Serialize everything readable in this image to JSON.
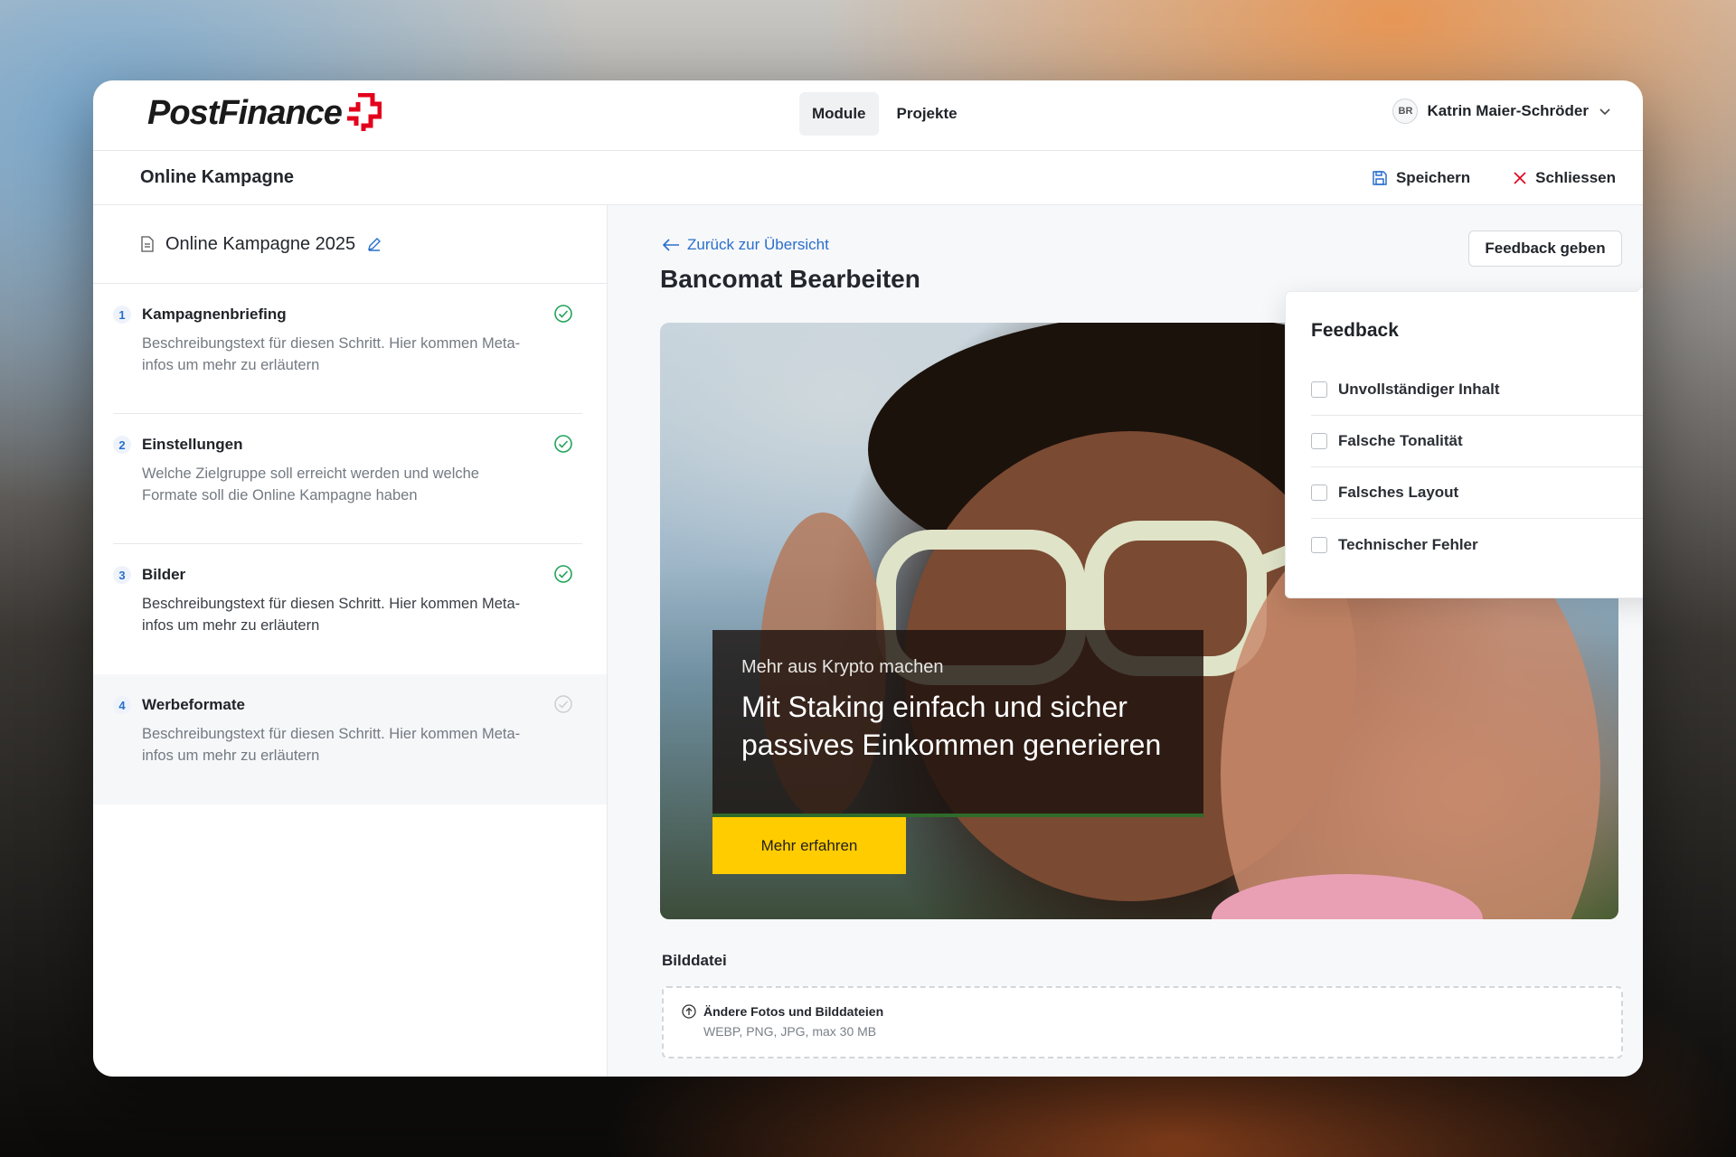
{
  "brand": {
    "logo_text": "PostFinance",
    "accent": "#e3001b"
  },
  "nav": {
    "items": [
      {
        "label": "Module",
        "active": true
      },
      {
        "label": "Projekte",
        "active": false
      }
    ]
  },
  "user": {
    "initials": "BR",
    "name": "Katrin Maier-Schröder"
  },
  "subheader": {
    "title": "Online Kampagne",
    "save_label": "Speichern",
    "close_label": "Schliessen"
  },
  "sidebar": {
    "project_name": "Online Kampagne 2025",
    "steps": [
      {
        "number": "1",
        "title": "Kampagnenbriefing",
        "description": "Beschreibungstext für diesen Schritt. Hier kommen Meta-infos um mehr zu erläutern",
        "status": "done"
      },
      {
        "number": "2",
        "title": "Einstellungen",
        "description": "Welche Zielgruppe soll erreicht werden und welche Formate soll die Online Kampagne haben",
        "status": "done"
      },
      {
        "number": "3",
        "title": "Bilder",
        "description": "Beschreibungstext für diesen Schritt. Hier kommen Meta-infos um mehr zu erläutern",
        "status": "done"
      },
      {
        "number": "4",
        "title": "Werbeformate",
        "description": "Beschreibungstext für diesen Schritt. Hier kommen Meta-infos um mehr zu erläutern",
        "status": "pending"
      }
    ]
  },
  "main": {
    "back_label": "Zurück zur Übersicht",
    "title": "Bancomat Bearbeiten",
    "feedback_button": "Feedback geben",
    "hero": {
      "kicker": "Mehr aus Krypto machen",
      "headline": "Mit Staking einfach und sicher passives Einkommen generieren",
      "cta": "Mehr erfahren",
      "cta_color": "#ffcc00"
    },
    "feedback": {
      "title": "Feedback",
      "options": [
        "Unvollständiger Inhalt",
        "Falsche Tonalität",
        "Falsches Layout",
        "Technischer Fehler"
      ]
    },
    "file": {
      "label": "Bilddatei",
      "upload_label": "Ändere Fotos und Bilddateien",
      "upload_hint": "WEBP, PNG, JPG, max 30 MB"
    }
  }
}
